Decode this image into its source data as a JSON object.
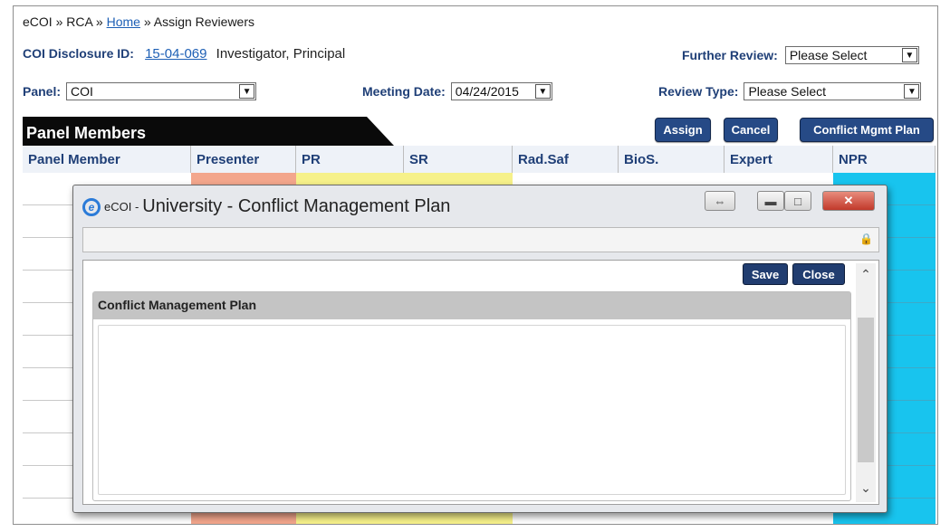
{
  "breadcrumb": {
    "part1": "eCOI » RCA »",
    "home": "Home",
    "part2": "» Assign Reviewers"
  },
  "disclosure": {
    "label": "COI Disclosure ID:",
    "id": "15-04-069",
    "investigator": "Investigator, Principal"
  },
  "further_review": {
    "label": "Further Review:",
    "value": "Please Select"
  },
  "panel": {
    "label": "Panel:",
    "value": "COI"
  },
  "meeting_date": {
    "label": "Meeting Date:",
    "value": "04/24/2015"
  },
  "review_type": {
    "label": "Review Type:",
    "value": "Please Select"
  },
  "panel_members": {
    "title": "Panel Members",
    "columns": [
      "Panel Member",
      "Presenter",
      "PR",
      "SR",
      "Rad.Saf",
      "BioS.",
      "Expert",
      "NPR"
    ]
  },
  "buttons": {
    "assign": "Assign",
    "cancel": "Cancel",
    "conflict_plan": "Conflict Mgmt Plan"
  },
  "dialog": {
    "window_short": "eCOI -",
    "window_title": "University - Conflict Management Plan",
    "save": "Save",
    "close": "Close",
    "section_title": "Conflict Management Plan",
    "plan_text": ""
  },
  "colors": {
    "presenter_col": "#f3a68c",
    "pr_col": "#f6f18a",
    "sr_col": "#f6f18a",
    "npr_col": "#18c4ee",
    "header_text": "#1f3f77",
    "button": "#264a86"
  }
}
